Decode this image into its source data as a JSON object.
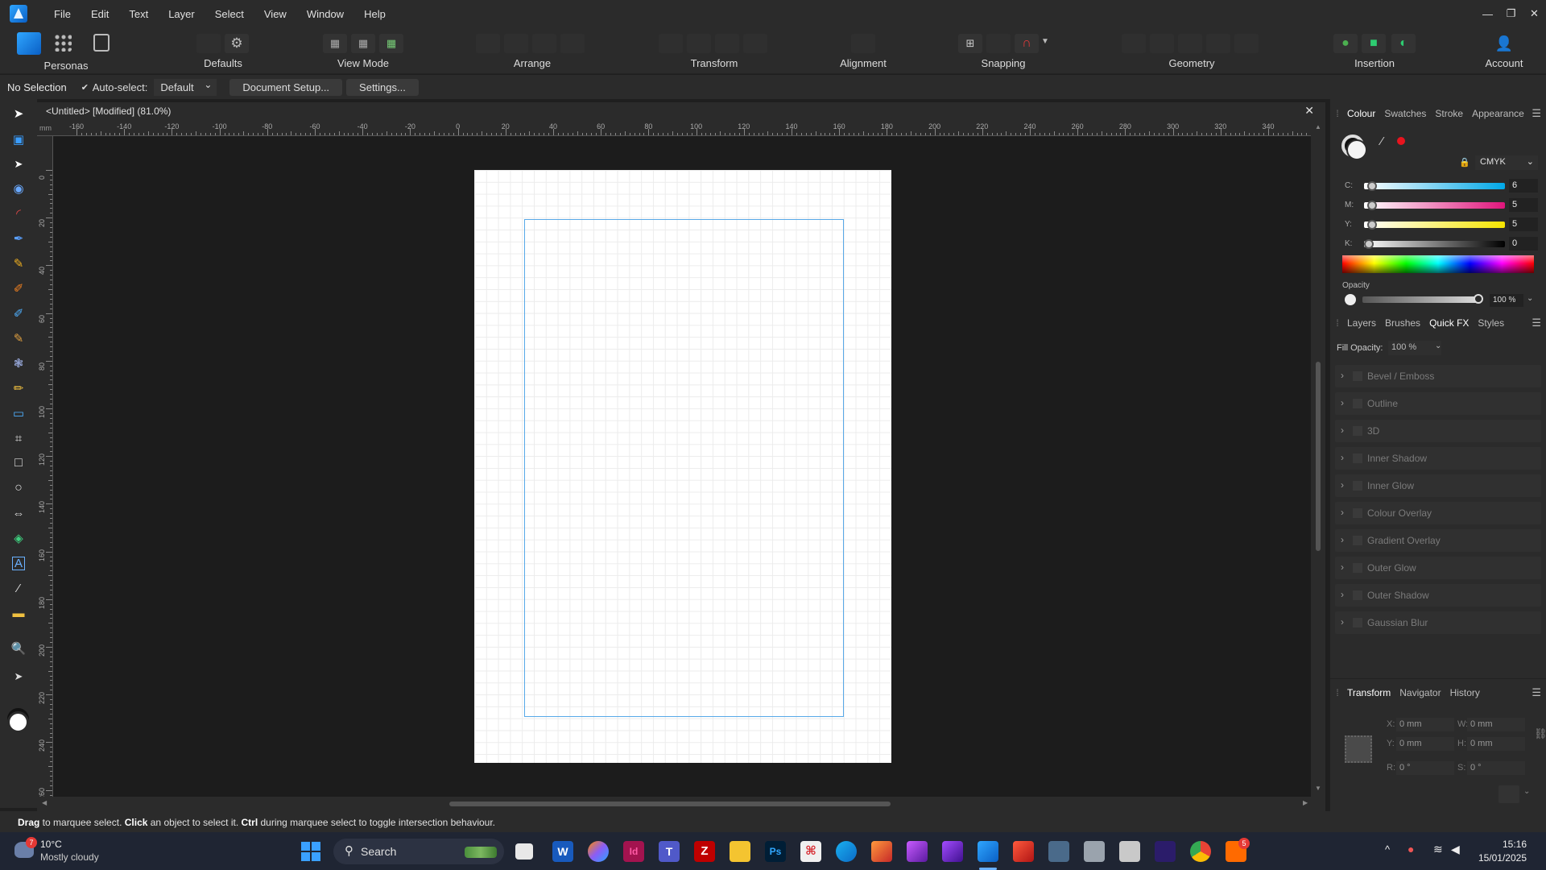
{
  "menu": [
    "File",
    "Edit",
    "Text",
    "Layer",
    "Select",
    "View",
    "Window",
    "Help"
  ],
  "toolbar": {
    "personas": "Personas",
    "defaults": "Defaults",
    "view_mode": "View Mode",
    "arrange": "Arrange",
    "transform": "Transform",
    "alignment": "Alignment",
    "snapping": "Snapping",
    "geometry": "Geometry",
    "insertion": "Insertion",
    "account": "Account"
  },
  "context": {
    "selection": "No Selection",
    "auto_select_label": "Auto-select:",
    "auto_select_value": "Default",
    "document_setup": "Document Setup...",
    "settings": "Settings..."
  },
  "document": {
    "tab_title": "<Untitled> [Modified] (81.0%)",
    "ruler_unit": "mm",
    "ruler_h_labels": [
      "-160",
      "-140",
      "-120",
      "-100",
      "-80",
      "-60",
      "-40",
      "-20",
      "0",
      "20",
      "40",
      "60",
      "80",
      "100",
      "120",
      "140",
      "160",
      "180",
      "200",
      "220",
      "240",
      "260",
      "280",
      "300",
      "320",
      "340"
    ],
    "ruler_v_labels": [
      "0",
      "20",
      "40",
      "60",
      "80",
      "100",
      "120",
      "140",
      "160",
      "180",
      "200",
      "220",
      "240",
      "260"
    ]
  },
  "colour_panel": {
    "tabs": [
      "Colour",
      "Swatches",
      "Stroke",
      "Appearance"
    ],
    "model": "CMYK",
    "channels": [
      {
        "label": "C:",
        "value": "6",
        "gradient": "linear-gradient(to right,#ffffff,#00a8e8)"
      },
      {
        "label": "M:",
        "value": "5",
        "gradient": "linear-gradient(to right,#ffffff,#e0157c)"
      },
      {
        "label": "Y:",
        "value": "5",
        "gradient": "linear-gradient(to right,#ffffff,#f5e400)"
      },
      {
        "label": "K:",
        "value": "0",
        "gradient": "linear-gradient(to right,#ffffff,#000000)"
      }
    ],
    "opacity_label": "Opacity",
    "opacity_value": "100 %"
  },
  "fx_panel": {
    "tabs": [
      "Layers",
      "Brushes",
      "Quick FX",
      "Styles"
    ],
    "fill_opacity_label": "Fill Opacity:",
    "fill_opacity_value": "100 %",
    "effects": [
      "Bevel / Emboss",
      "Outline",
      "3D",
      "Inner Shadow",
      "Inner Glow",
      "Colour Overlay",
      "Gradient Overlay",
      "Outer Glow",
      "Outer Shadow",
      "Gaussian Blur"
    ]
  },
  "transform_panel": {
    "tabs": [
      "Transform",
      "Navigator",
      "History"
    ],
    "fields": [
      {
        "label": "X:",
        "value": "0 mm"
      },
      {
        "label": "W:",
        "value": "0 mm"
      },
      {
        "label": "Y:",
        "value": "0 mm"
      },
      {
        "label": "H:",
        "value": "0 mm"
      },
      {
        "label": "R:",
        "value": "0 °"
      },
      {
        "label": "S:",
        "value": "0 °"
      }
    ]
  },
  "status": {
    "drag": "Drag",
    "t1": " to marquee select. ",
    "click": "Click",
    "t2": " an object to select it. ",
    "ctrl": "Ctrl",
    "t3": " during marquee select to toggle intersection behaviour."
  },
  "taskbar": {
    "weather_temp": "10°C",
    "weather_desc": "Mostly cloudy",
    "weather_badge": "7",
    "search_label": "Search",
    "time": "15:16",
    "date": "15/01/2025",
    "notification_badge": "5"
  },
  "colors": {
    "accent": "#2fa6ff",
    "margin_guide": "#58a9e8",
    "panel_bg": "#2b2b2b",
    "canvas_bg": "#1c1c1c"
  }
}
